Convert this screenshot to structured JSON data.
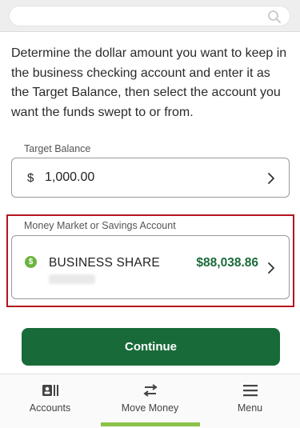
{
  "search": {
    "icon": "search-icon"
  },
  "intro_text": "Determine the dollar amount you want to keep in the business checking account and enter it as the Target Balance, then select the account you want the funds swept to or from.",
  "target_balance": {
    "label": "Target Balance",
    "currency_symbol": "$",
    "value": "1,000.00"
  },
  "account": {
    "label": "Money Market or Savings Account",
    "name": "BUSINESS SHARE",
    "balance": "$88,038.86",
    "icon": "dollar-circle-icon"
  },
  "continue_label": "Continue",
  "nav": {
    "items": [
      {
        "label": "Accounts",
        "icon": "accounts-icon"
      },
      {
        "label": "Move Money",
        "icon": "transfer-icon"
      },
      {
        "label": "Menu",
        "icon": "hamburger-icon"
      }
    ],
    "active": "Move Money"
  },
  "colors": {
    "primary_green": "#186b39",
    "accent_green": "#8bc34a",
    "highlight_red": "#b3141f"
  }
}
